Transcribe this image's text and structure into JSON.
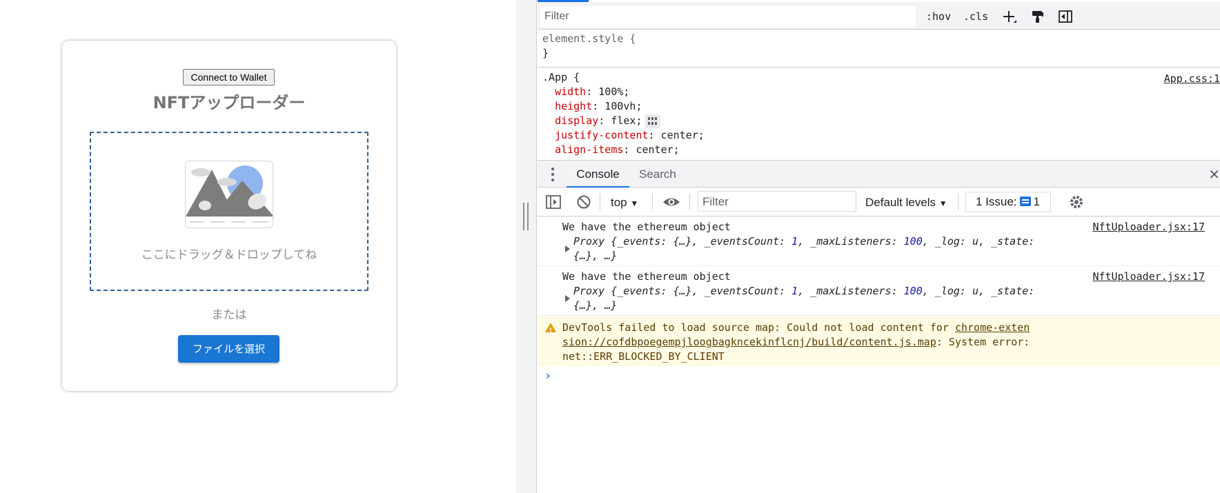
{
  "app": {
    "connect_button": "Connect to Wallet",
    "title": "NFTアップローダー",
    "dropzone_text": "ここにドラッグ＆ドロップしてね",
    "or_text": "または",
    "select_file_button": "ファイルを選択",
    "image_icon": "image-placeholder-icon",
    "colors": {
      "primary": "#1976d2",
      "dropzone_border": "#2f5f93",
      "muted_text": "#8a8a8a"
    }
  },
  "devtools": {
    "styles_filter_placeholder": "Filter",
    "hov_label": ":hov",
    "cls_label": ".cls",
    "element_style": {
      "selector": "element.style {",
      "close": "}"
    },
    "app_rule": {
      "selector": ".App {",
      "source": "App.css:1",
      "props": [
        {
          "name": "width",
          "value": " 100%;"
        },
        {
          "name": "height",
          "value": " 100vh;"
        },
        {
          "name": "display",
          "value": " flex;"
        },
        {
          "name": "justify-content",
          "value": " center;"
        },
        {
          "name": "align-items",
          "value": " center;"
        }
      ]
    },
    "drawer_tabs": [
      "Console",
      "Search"
    ],
    "console_toolbar": {
      "context": "top",
      "filter_placeholder": "Filter",
      "levels": "Default levels",
      "issues_label": "1 Issue:",
      "issues_count": "1"
    },
    "messages": [
      {
        "text": "We have the ethereum object",
        "source": "NftUploader.jsx:17",
        "obj_line1": {
          "a": "Proxy {_events: {…}, _eventsCount: ",
          "n1": "1",
          "b": ", _maxListeners: ",
          "n2": "100",
          "c": ", _log: u, _state:"
        },
        "obj_line2": "{…}, …}"
      },
      {
        "text": "We have the ethereum object",
        "source": "NftUploader.jsx:17",
        "obj_line1": {
          "a": "Proxy {_events: {…}, _eventsCount: ",
          "n1": "1",
          "b": ", _maxListeners: ",
          "n2": "100",
          "c": ", _log: u, _state:"
        },
        "obj_line2": "{…}, …}"
      }
    ],
    "warning": {
      "prefix": "DevTools failed to load source map: Could not load content for ",
      "link1": "chrome-exten",
      "link2": "sion://cofdbpoegempjloogbagkncekinflcnj/build/content.js.map",
      "suffix": ": System error:",
      "line3": "net::ERR_BLOCKED_BY_CLIENT"
    },
    "prompt": "›"
  }
}
